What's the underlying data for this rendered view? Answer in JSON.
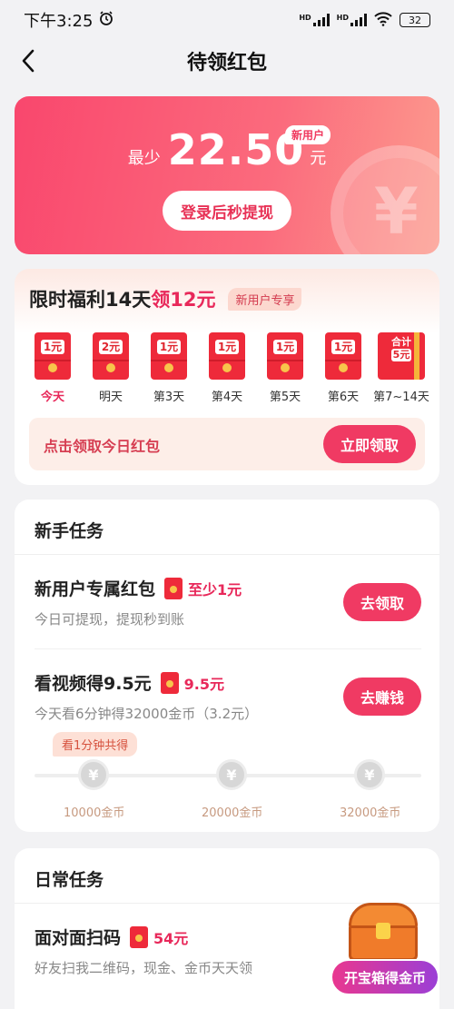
{
  "status_bar": {
    "time": "下午3:25",
    "net1": "HD",
    "net2": "HD",
    "battery": "32"
  },
  "nav": {
    "title": "待领红包"
  },
  "hero": {
    "prefix": "最少",
    "amount": "22.50",
    "unit": "元",
    "tag": "新用户",
    "button": "登录后秒提现"
  },
  "welfare": {
    "title_part1": "限时福利14天",
    "title_part2": "领12元",
    "tag": "新用户专享",
    "days": [
      {
        "value": "1元",
        "label": "今天"
      },
      {
        "value": "2元",
        "label": "明天"
      },
      {
        "value": "1元",
        "label": "第3天"
      },
      {
        "value": "1元",
        "label": "第4天"
      },
      {
        "value": "1元",
        "label": "第5天"
      },
      {
        "value": "1元",
        "label": "第6天"
      },
      {
        "value_top": "合计",
        "value": "5元",
        "label": "第7~14天"
      }
    ],
    "claim_text": "点击领取今日红包",
    "claim_button": "立即领取"
  },
  "newbie": {
    "title": "新手任务",
    "tasks": [
      {
        "name": "新用户专属红包",
        "reward": "至少1元",
        "desc": "今日可提现，提现秒到账",
        "button": "去领取"
      },
      {
        "name": "看视频得9.5元",
        "reward": "9.5元",
        "desc": "今天看6分钟得32000金币（3.2元）",
        "button": "去赚钱"
      }
    ],
    "progress": {
      "tip": "看1分钟共得",
      "nodes": [
        {
          "icon": "¥",
          "label": "10000金币"
        },
        {
          "icon": "¥",
          "label": "20000金币"
        },
        {
          "icon": "¥",
          "label": "32000金币"
        }
      ]
    }
  },
  "daily": {
    "title": "日常任务",
    "tasks": [
      {
        "name": "面对面扫码",
        "reward": "54元",
        "desc": "好友扫我二维码，现金、金币天天领"
      }
    ]
  },
  "treasure": {
    "button": "开宝箱得金币"
  }
}
